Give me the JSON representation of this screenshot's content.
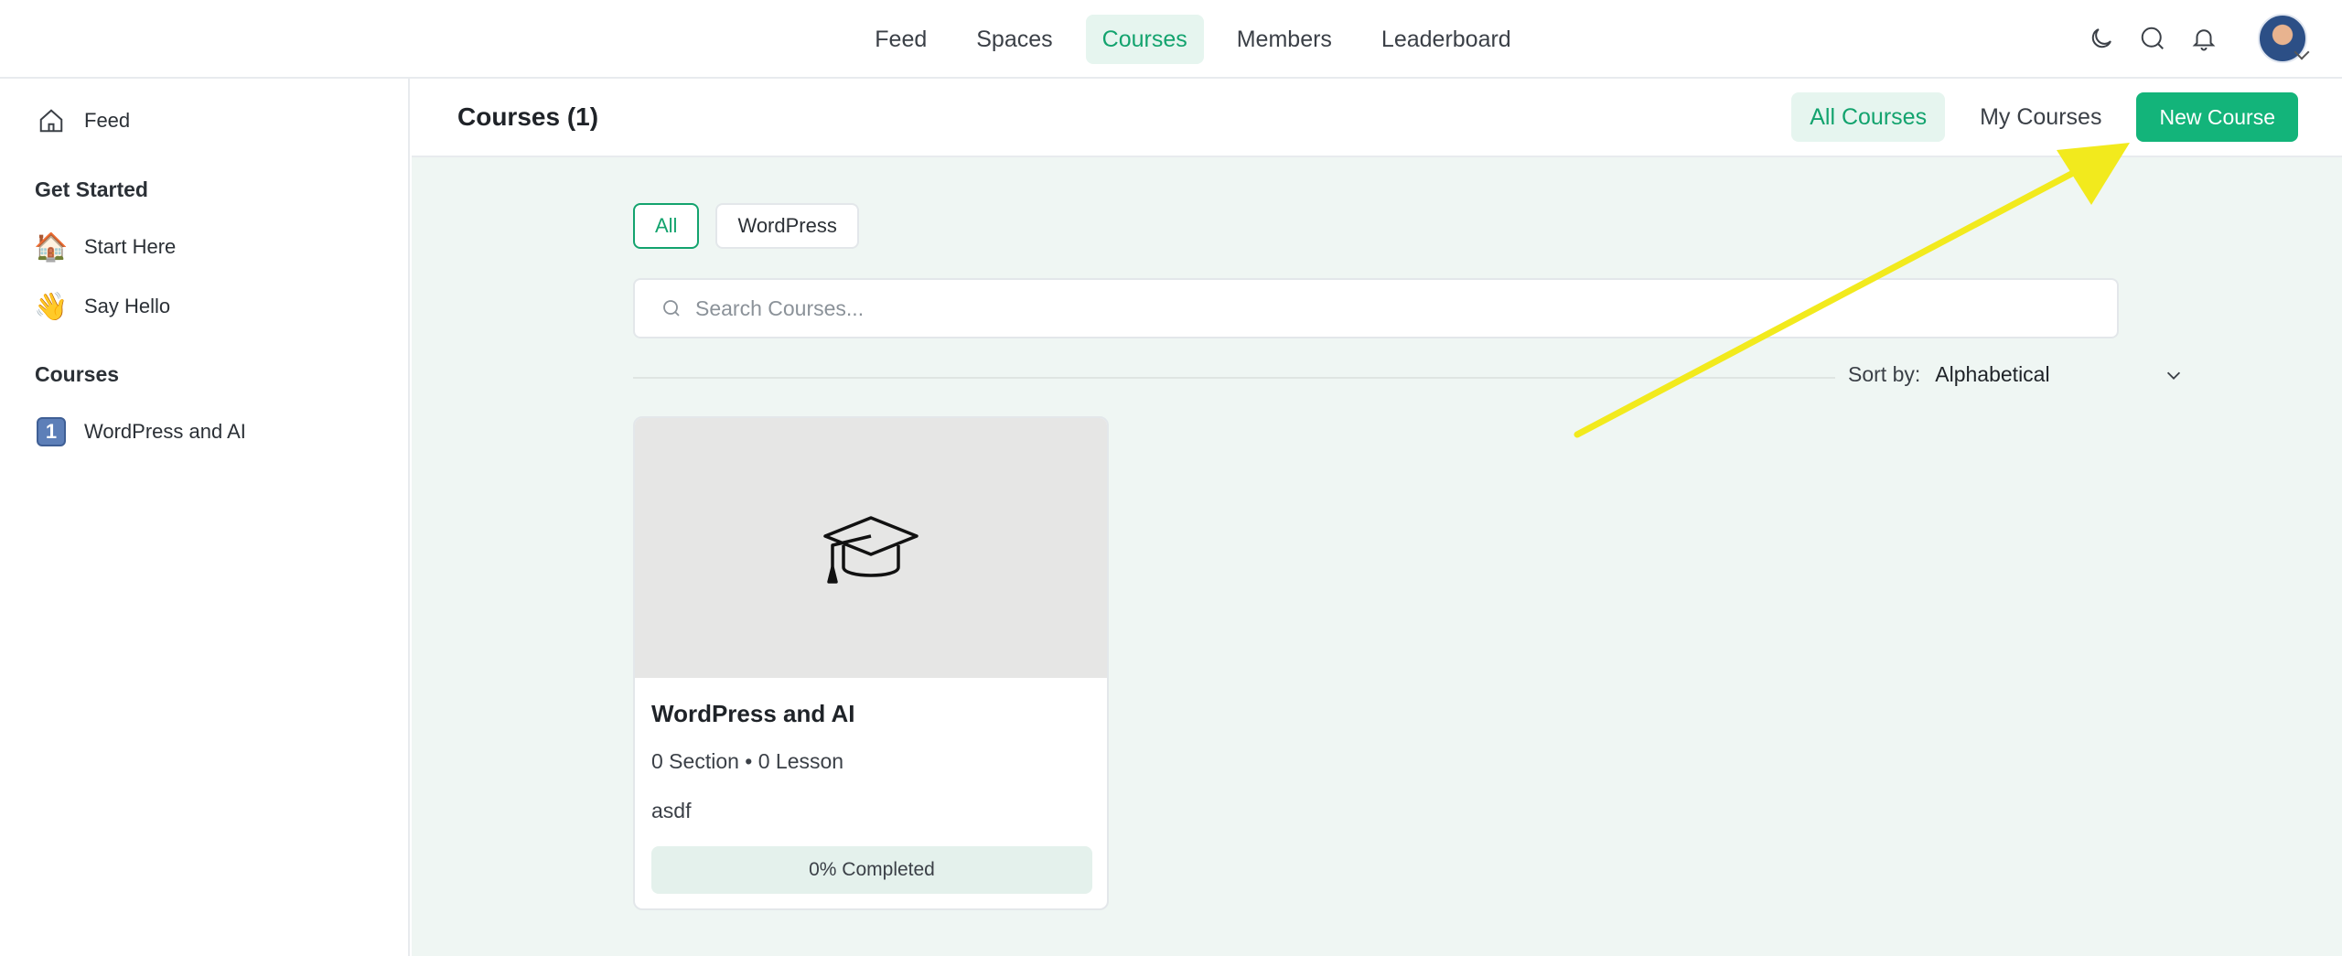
{
  "nav": {
    "items": [
      {
        "label": "Feed",
        "active": false
      },
      {
        "label": "Spaces",
        "active": false
      },
      {
        "label": "Courses",
        "active": true
      },
      {
        "label": "Members",
        "active": false
      },
      {
        "label": "Leaderboard",
        "active": false
      }
    ],
    "icons": [
      "moon-icon",
      "search-icon",
      "bell-icon"
    ]
  },
  "sidebar": {
    "feed_label": "Feed",
    "get_started_heading": "Get Started",
    "get_started_items": [
      {
        "emoji": "🏠",
        "label": "Start Here"
      },
      {
        "emoji": "👋",
        "label": "Say Hello"
      }
    ],
    "courses_heading": "Courses",
    "course_items": [
      {
        "emoji": "1",
        "label": "WordPress and AI"
      }
    ]
  },
  "header": {
    "title": "Courses (1)",
    "all_courses_label": "All Courses",
    "my_courses_label": "My Courses",
    "new_course_label": "New Course"
  },
  "filters": {
    "all_label": "All",
    "wordpress_label": "WordPress"
  },
  "search": {
    "placeholder": "Search Courses...",
    "value": ""
  },
  "sort": {
    "label": "Sort by:",
    "value": "Alphabetical"
  },
  "card": {
    "title": "WordPress and AI",
    "meta": "0 Section • 0 Lesson",
    "description": "asdf",
    "progress_label": "0% Completed",
    "progress_percent": 0
  },
  "colors": {
    "accent": "#13b47a",
    "accent_soft": "#e6f5ef",
    "content_bg": "#eff6f3",
    "annotation": "#f2ea1d"
  }
}
